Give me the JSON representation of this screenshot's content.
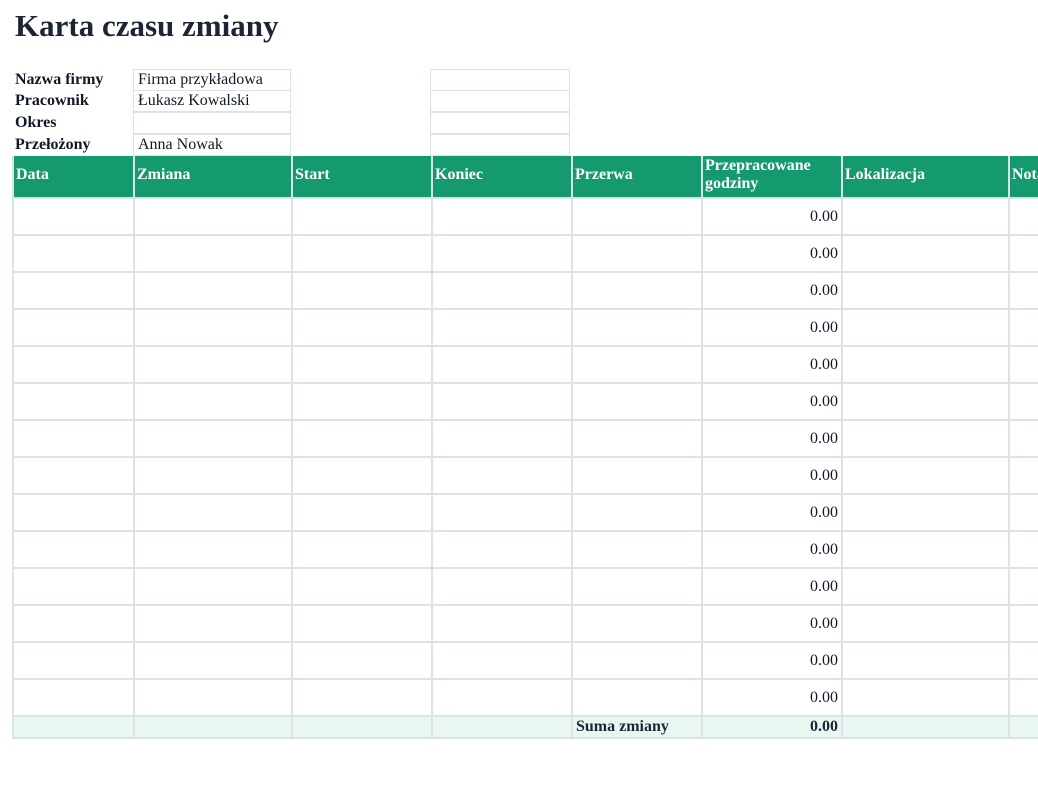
{
  "sheet": {
    "title": "Karta czasu zmiany"
  },
  "info": {
    "company_label": "Nazwa firmy",
    "company_value": "Firma przykładowa",
    "employee_label": "Pracownik",
    "employee_value": "Łukasz Kowalski",
    "period_label": "Okres",
    "period_value": "",
    "supervisor_label": "Przełożony",
    "supervisor_value": "Anna Nowak"
  },
  "table": {
    "headers": {
      "date": "Data",
      "shift": "Zmiana",
      "start": "Start",
      "end": "Koniec",
      "break": "Przerwa",
      "hours": "Przepracowane godziny",
      "location": "Lokalizacja",
      "notes": "Notatki"
    },
    "rows": [
      {
        "hours": "0.00"
      },
      {
        "hours": "0.00"
      },
      {
        "hours": "0.00"
      },
      {
        "hours": "0.00"
      },
      {
        "hours": "0.00"
      },
      {
        "hours": "0.00"
      },
      {
        "hours": "0.00"
      },
      {
        "hours": "0.00"
      },
      {
        "hours": "0.00"
      },
      {
        "hours": "0.00"
      },
      {
        "hours": "0.00"
      },
      {
        "hours": "0.00"
      },
      {
        "hours": "0.00"
      },
      {
        "hours": "0.00"
      }
    ],
    "summary": {
      "label": "Suma zmiany",
      "total": "0.00"
    }
  }
}
